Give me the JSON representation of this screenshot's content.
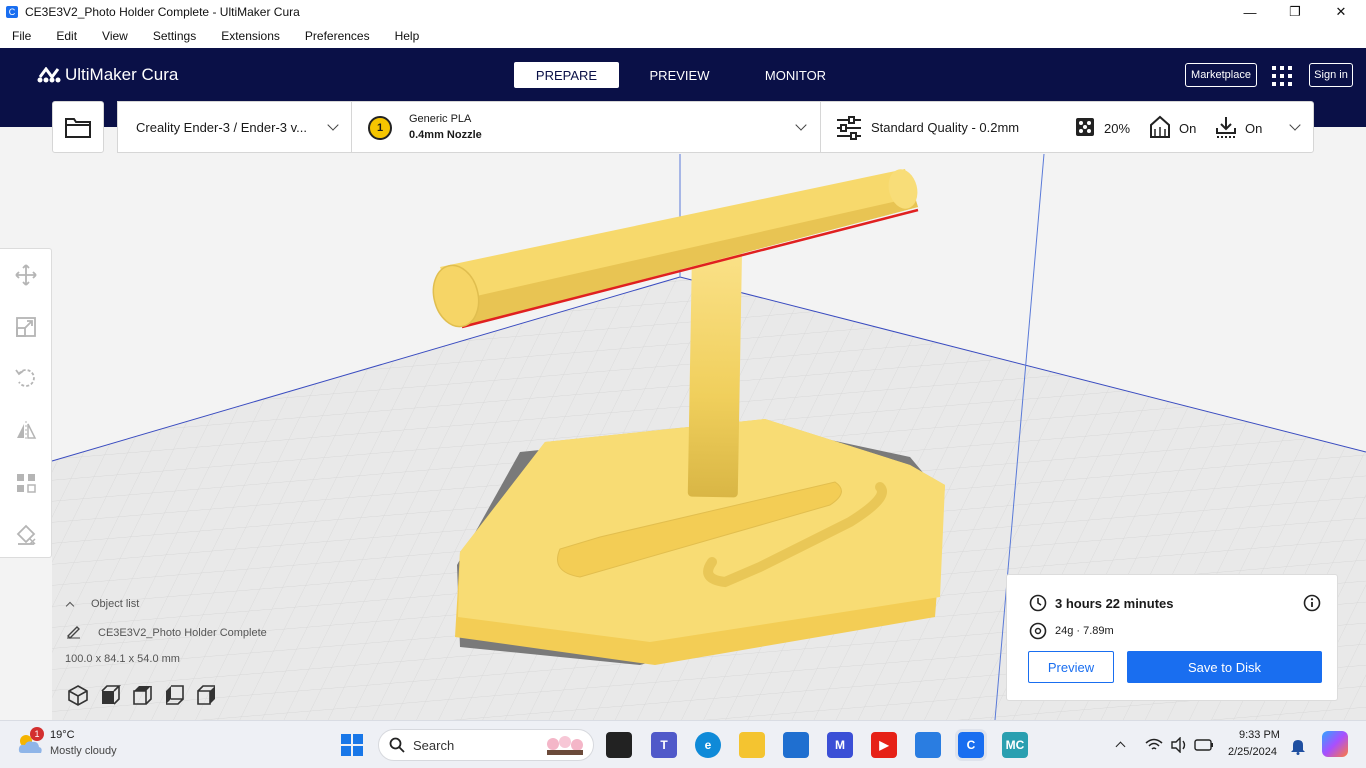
{
  "window": {
    "title": "CE3E3V2_Photo Holder Complete - UltiMaker Cura",
    "minimize_glyph": "—",
    "restore_glyph": "❐",
    "close_glyph": "✕"
  },
  "menu": [
    "File",
    "Edit",
    "View",
    "Settings",
    "Extensions",
    "Preferences",
    "Help"
  ],
  "header": {
    "brand": "UltiMaker Cura",
    "stages": [
      "PREPARE",
      "PREVIEW",
      "MONITOR"
    ],
    "active_stage": "PREPARE",
    "marketplace_label": "Marketplace",
    "signin_label": "Sign in"
  },
  "printer": {
    "label": "Creality Ender-3 / Ender-3 v..."
  },
  "material": {
    "extruder_number": "1",
    "name": "Generic PLA",
    "nozzle": "0.4mm Nozzle"
  },
  "print_settings": {
    "profile": "Standard Quality - 0.2mm",
    "infill": "20%",
    "support": "On",
    "adhesion": "On"
  },
  "object_list": {
    "heading": "Object list",
    "object_name": "CE3E3V2_Photo Holder Complete",
    "dimensions": "100.0 x 84.1 x 54.0 mm"
  },
  "print_panel": {
    "time": "3 hours 22 minutes",
    "usage": "24g · 7.89m",
    "preview_label": "Preview",
    "save_label": "Save to Disk"
  },
  "taskbar": {
    "weather_temp": "19°C",
    "weather_desc": "Mostly cloudy",
    "weather_badge": "1",
    "search_placeholder": "Search",
    "time": "9:33 PM",
    "date": "2/25/2024"
  },
  "colors": {
    "header_bg": "#0a1047",
    "accent": "#196ef0",
    "model_yellow": "#f5d667"
  }
}
